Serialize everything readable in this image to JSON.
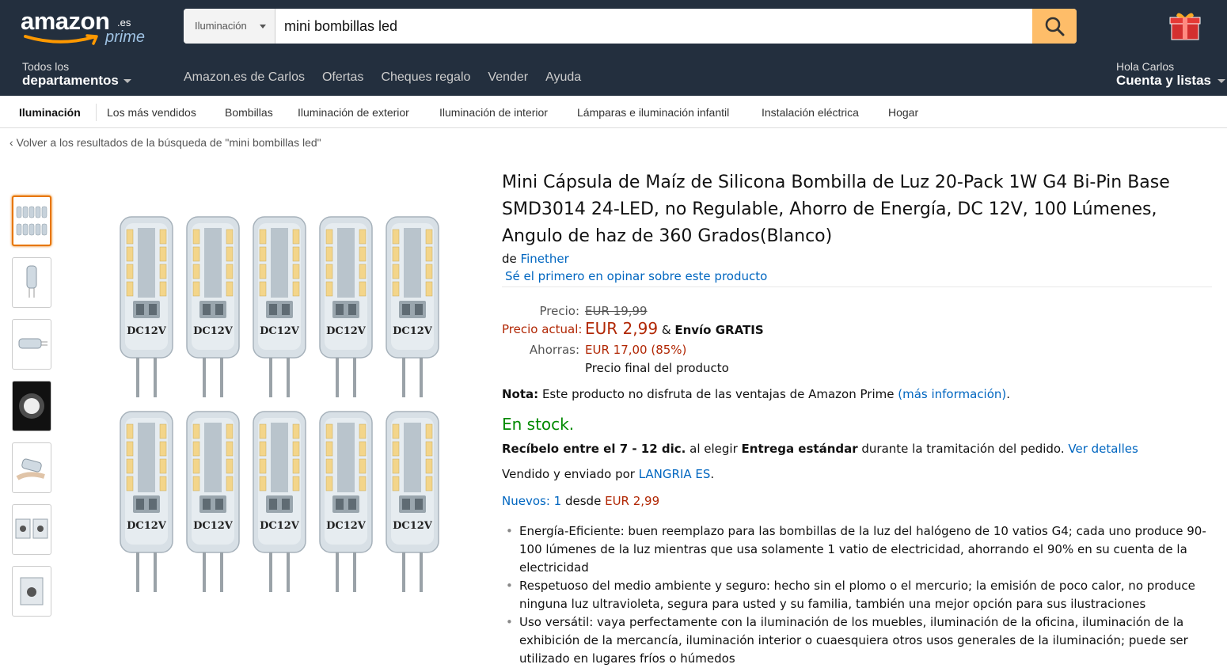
{
  "header": {
    "logo_word": "amazon",
    "logo_tld": ".es",
    "logo_prime": "prime",
    "search_category": "Iluminación",
    "search_value": "mini bombillas led",
    "depts_line1": "Todos los",
    "depts_line2": "departamentos",
    "nav_links": [
      "Amazon.es de Carlos",
      "Ofertas",
      "Cheques regalo",
      "Vender",
      "Ayuda"
    ],
    "account_line1": "Hola Carlos",
    "account_line2": "Cuenta y listas"
  },
  "subnav": [
    "Iluminación",
    "Los más vendidos",
    "Bombillas",
    "Iluminación de exterior",
    "Iluminación de interior",
    "Lámparas e iluminación infantil",
    "Instalación eléctrica",
    "Hogar"
  ],
  "back_link": "Volver a los resultados de la búsqueda de \"mini bombillas led\"",
  "back_arrow": "‹",
  "product": {
    "title": "Mini Cápsula de Maíz de Silicona Bombilla de Luz 20-Pack 1W G4 Bi-Pin Base SMD3014 24-LED, no Regulable, Ahorro de Energía, DC 12V, 100 Lúmenes, Angulo de haz de 360 Grados(Blanco)",
    "by_prefix": "de",
    "brand": "Finether",
    "review_link": "Sé el primero en opinar sobre este producto",
    "bulb_label": "DC12V"
  },
  "price": {
    "label_price": "Precio:",
    "list_price": "EUR 19,99",
    "label_current": "Precio actual:",
    "current_price": "EUR 2,99",
    "amp": "&",
    "shipping": "Envío GRATIS",
    "label_savings": "Ahorras:",
    "savings": "EUR 17,00 (85%)",
    "final_note": "Precio final del producto"
  },
  "nota": {
    "label": "Nota:",
    "text": "Este producto no disfruta de las ventajas de Amazon Prime",
    "link": "(más información)",
    "end": "."
  },
  "stock": "En stock.",
  "delivery": {
    "bold1": "Recíbelo entre el 7 - 12 dic.",
    "text1": "al elegir",
    "bold2": "Entrega estándar",
    "text2": "durante la tramitación del pedido.",
    "link": "Ver detalles"
  },
  "seller": {
    "prefix": "Vendido y enviado por",
    "name": "LANGRIA ES",
    "end": "."
  },
  "offers": {
    "link": "Nuevos: 1",
    "text": "desde",
    "price": "EUR 2,99"
  },
  "bullets": [
    "Energía-Eficiente: buen reemplazo para las bombillas de la luz del halógeno de 10 vatios G4; cada uno produce 90-100 lúmenes de la luz mientras que usa solamente 1 vatio de electricidad, ahorrando el 90% en su cuenta de la electricidad",
    "Respetuoso del medio ambiente y seguro: hecho sin el plomo o el mercurio; la emisión de poco calor, no produce ninguna luz ultravioleta, segura para usted y su familia, también una mejor opción para sus ilustraciones",
    "Uso versátil: vaya perfectamente con la iluminación de los muebles, iluminación de la oficina, iluminación de la exhibición de la mercancía, iluminación interior o cuaesquiera otros usos generales de la iluminación; puede ser utilizado en lugares fríos o húmedos"
  ],
  "colors": {
    "header_bg": "#232f3e",
    "search_button": "#febd69",
    "link": "#0066c0",
    "price_red": "#b12704",
    "stock_green": "#008a00",
    "thumb_active": "#e77600"
  }
}
